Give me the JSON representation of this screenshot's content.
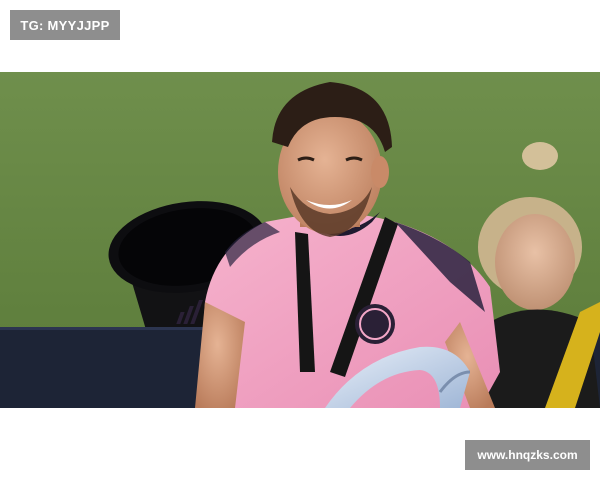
{
  "watermark": {
    "top_left_label": "TG: MYYJJPP",
    "bottom_right_label": "www.hnqzks.com"
  },
  "photo": {
    "scene": "soccer player in pink jersey holding trophy on pitch"
  },
  "colors": {
    "badge_bg": "#8e8e8e",
    "badge_text": "#ffffff",
    "pitch": "#6d8d4a",
    "jersey": "#f2a2c2",
    "ad_board": "#1d2436"
  }
}
